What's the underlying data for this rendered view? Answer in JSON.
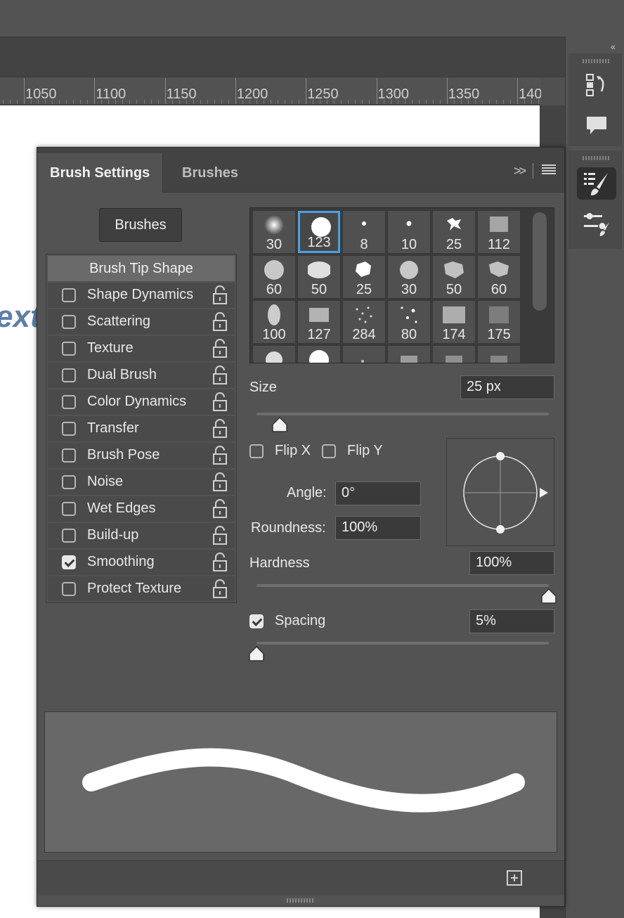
{
  "ruler": {
    "labels": [
      "1050",
      "1100",
      "1150",
      "1200",
      "1250",
      "1300",
      "1350",
      "140"
    ]
  },
  "canvas": {
    "partial_text": "ext"
  },
  "dock": {
    "collapse_glyph": "‹‹",
    "icons": [
      "history-icon",
      "comment-icon",
      "brush-settings-icon",
      "brush-presets-icon"
    ]
  },
  "panel": {
    "tabs": [
      {
        "label": "Brush Settings",
        "active": true
      },
      {
        "label": "Brushes",
        "active": false
      }
    ],
    "menu": {
      "expand_glyph": ">>",
      "menu_glyph": "≡"
    },
    "brushes_button": "Brushes",
    "tip_shape_label": "Brush Tip Shape",
    "options": [
      {
        "label": "Shape Dynamics",
        "checked": false
      },
      {
        "label": "Scattering",
        "checked": false
      },
      {
        "label": "Texture",
        "checked": false
      },
      {
        "label": "Dual Brush",
        "checked": false
      },
      {
        "label": "Color Dynamics",
        "checked": false
      },
      {
        "label": "Transfer",
        "checked": false
      },
      {
        "label": "Brush Pose",
        "checked": false
      },
      {
        "label": "Noise",
        "checked": false
      },
      {
        "label": "Wet Edges",
        "checked": false
      },
      {
        "label": "Build-up",
        "checked": false
      },
      {
        "label": "Smoothing",
        "checked": true
      },
      {
        "label": "Protect Texture",
        "checked": false
      }
    ],
    "brush_grid": [
      "30",
      "123",
      "8",
      "10",
      "25",
      "112",
      "60",
      "50",
      "25",
      "30",
      "50",
      "60",
      "100",
      "127",
      "284",
      "80",
      "174",
      "175"
    ],
    "selected_brush": "123",
    "size": {
      "label": "Size",
      "value": "25 px",
      "fraction": 0.08
    },
    "flip_x": {
      "label": "Flip X",
      "checked": false
    },
    "flip_y": {
      "label": "Flip Y",
      "checked": false
    },
    "angle": {
      "label": "Angle:",
      "value": "0°"
    },
    "roundness": {
      "label": "Roundness:",
      "value": "100%"
    },
    "hardness": {
      "label": "Hardness",
      "value": "100%",
      "fraction": 1.0
    },
    "spacing": {
      "label": "Spacing",
      "value": "5%",
      "checked": true,
      "fraction": 0.0
    }
  },
  "colors": {
    "accent": "#4aa0e6",
    "panel_bg": "#535353",
    "preview_bg": "#686868"
  }
}
